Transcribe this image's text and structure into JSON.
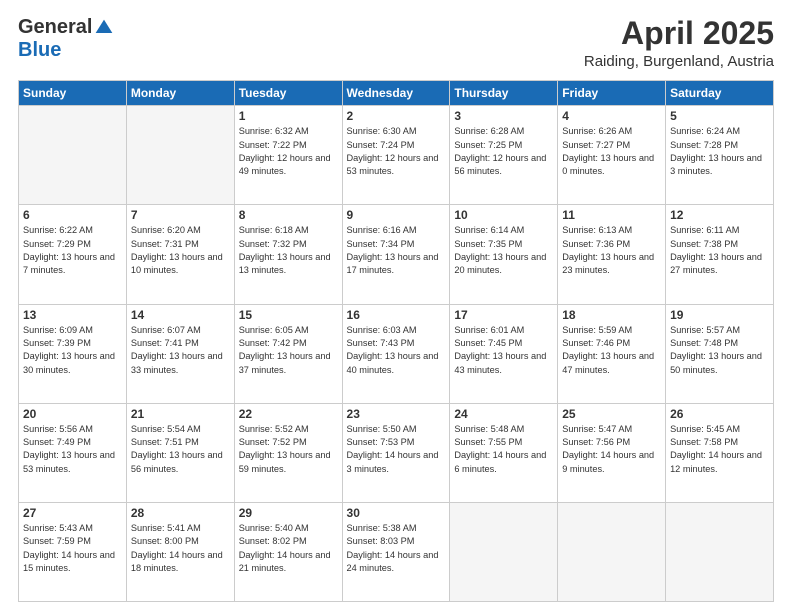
{
  "logo": {
    "general": "General",
    "blue": "Blue"
  },
  "header": {
    "month": "April 2025",
    "location": "Raiding, Burgenland, Austria"
  },
  "days_of_week": [
    "Sunday",
    "Monday",
    "Tuesday",
    "Wednesday",
    "Thursday",
    "Friday",
    "Saturday"
  ],
  "weeks": [
    [
      {
        "day": "",
        "info": ""
      },
      {
        "day": "",
        "info": ""
      },
      {
        "day": "1",
        "info": "Sunrise: 6:32 AM\nSunset: 7:22 PM\nDaylight: 12 hours and 49 minutes."
      },
      {
        "day": "2",
        "info": "Sunrise: 6:30 AM\nSunset: 7:24 PM\nDaylight: 12 hours and 53 minutes."
      },
      {
        "day": "3",
        "info": "Sunrise: 6:28 AM\nSunset: 7:25 PM\nDaylight: 12 hours and 56 minutes."
      },
      {
        "day": "4",
        "info": "Sunrise: 6:26 AM\nSunset: 7:27 PM\nDaylight: 13 hours and 0 minutes."
      },
      {
        "day": "5",
        "info": "Sunrise: 6:24 AM\nSunset: 7:28 PM\nDaylight: 13 hours and 3 minutes."
      }
    ],
    [
      {
        "day": "6",
        "info": "Sunrise: 6:22 AM\nSunset: 7:29 PM\nDaylight: 13 hours and 7 minutes."
      },
      {
        "day": "7",
        "info": "Sunrise: 6:20 AM\nSunset: 7:31 PM\nDaylight: 13 hours and 10 minutes."
      },
      {
        "day": "8",
        "info": "Sunrise: 6:18 AM\nSunset: 7:32 PM\nDaylight: 13 hours and 13 minutes."
      },
      {
        "day": "9",
        "info": "Sunrise: 6:16 AM\nSunset: 7:34 PM\nDaylight: 13 hours and 17 minutes."
      },
      {
        "day": "10",
        "info": "Sunrise: 6:14 AM\nSunset: 7:35 PM\nDaylight: 13 hours and 20 minutes."
      },
      {
        "day": "11",
        "info": "Sunrise: 6:13 AM\nSunset: 7:36 PM\nDaylight: 13 hours and 23 minutes."
      },
      {
        "day": "12",
        "info": "Sunrise: 6:11 AM\nSunset: 7:38 PM\nDaylight: 13 hours and 27 minutes."
      }
    ],
    [
      {
        "day": "13",
        "info": "Sunrise: 6:09 AM\nSunset: 7:39 PM\nDaylight: 13 hours and 30 minutes."
      },
      {
        "day": "14",
        "info": "Sunrise: 6:07 AM\nSunset: 7:41 PM\nDaylight: 13 hours and 33 minutes."
      },
      {
        "day": "15",
        "info": "Sunrise: 6:05 AM\nSunset: 7:42 PM\nDaylight: 13 hours and 37 minutes."
      },
      {
        "day": "16",
        "info": "Sunrise: 6:03 AM\nSunset: 7:43 PM\nDaylight: 13 hours and 40 minutes."
      },
      {
        "day": "17",
        "info": "Sunrise: 6:01 AM\nSunset: 7:45 PM\nDaylight: 13 hours and 43 minutes."
      },
      {
        "day": "18",
        "info": "Sunrise: 5:59 AM\nSunset: 7:46 PM\nDaylight: 13 hours and 47 minutes."
      },
      {
        "day": "19",
        "info": "Sunrise: 5:57 AM\nSunset: 7:48 PM\nDaylight: 13 hours and 50 minutes."
      }
    ],
    [
      {
        "day": "20",
        "info": "Sunrise: 5:56 AM\nSunset: 7:49 PM\nDaylight: 13 hours and 53 minutes."
      },
      {
        "day": "21",
        "info": "Sunrise: 5:54 AM\nSunset: 7:51 PM\nDaylight: 13 hours and 56 minutes."
      },
      {
        "day": "22",
        "info": "Sunrise: 5:52 AM\nSunset: 7:52 PM\nDaylight: 13 hours and 59 minutes."
      },
      {
        "day": "23",
        "info": "Sunrise: 5:50 AM\nSunset: 7:53 PM\nDaylight: 14 hours and 3 minutes."
      },
      {
        "day": "24",
        "info": "Sunrise: 5:48 AM\nSunset: 7:55 PM\nDaylight: 14 hours and 6 minutes."
      },
      {
        "day": "25",
        "info": "Sunrise: 5:47 AM\nSunset: 7:56 PM\nDaylight: 14 hours and 9 minutes."
      },
      {
        "day": "26",
        "info": "Sunrise: 5:45 AM\nSunset: 7:58 PM\nDaylight: 14 hours and 12 minutes."
      }
    ],
    [
      {
        "day": "27",
        "info": "Sunrise: 5:43 AM\nSunset: 7:59 PM\nDaylight: 14 hours and 15 minutes."
      },
      {
        "day": "28",
        "info": "Sunrise: 5:41 AM\nSunset: 8:00 PM\nDaylight: 14 hours and 18 minutes."
      },
      {
        "day": "29",
        "info": "Sunrise: 5:40 AM\nSunset: 8:02 PM\nDaylight: 14 hours and 21 minutes."
      },
      {
        "day": "30",
        "info": "Sunrise: 5:38 AM\nSunset: 8:03 PM\nDaylight: 14 hours and 24 minutes."
      },
      {
        "day": "",
        "info": ""
      },
      {
        "day": "",
        "info": ""
      },
      {
        "day": "",
        "info": ""
      }
    ]
  ]
}
